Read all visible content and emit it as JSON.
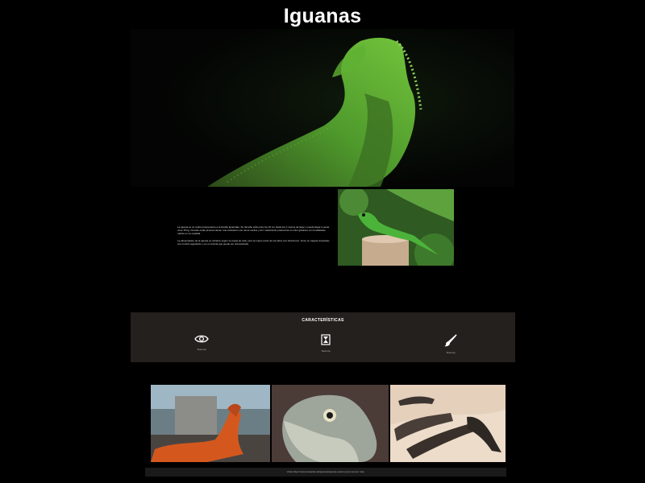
{
  "page": {
    "title": "Iguanas"
  },
  "intro": {
    "paragraphs": [
      "La iguana es un reptil perteneciente a la familia Iguanidae. Su tamaño está entre los 15 cm hasta los 2 metros de largo y puede llegar a pesar unos 15 kg. Cuando están jóvenes tienen una coloración con tonos verdes y al ir madurando predomina un color grisáceo con tonalidades rojizas en su espalda.",
      "La alimentación de la iguana es variante según su etapa de vida, pero la mayor parte de sus años son herbívoros. Viven en lugares tropicales con mucha vegetación y es un animal que puede ser domesticado."
    ]
  },
  "features": {
    "title": "CARACTERÍSTICAS",
    "items": [
      {
        "icon": "eye-icon",
        "label": "Texto tip"
      },
      {
        "icon": "hourglass-icon",
        "label": "Texto tip"
      },
      {
        "icon": "brush-icon",
        "label": "Texto tip"
      }
    ]
  },
  "footer": {
    "text": "Visita https://www.aniaedia.cat/iguanas/iguana-verde/ para conocer más."
  },
  "colors": {
    "background": "#000000",
    "features_bg": "#24201d",
    "iguana_green": "#4f9a2c"
  }
}
